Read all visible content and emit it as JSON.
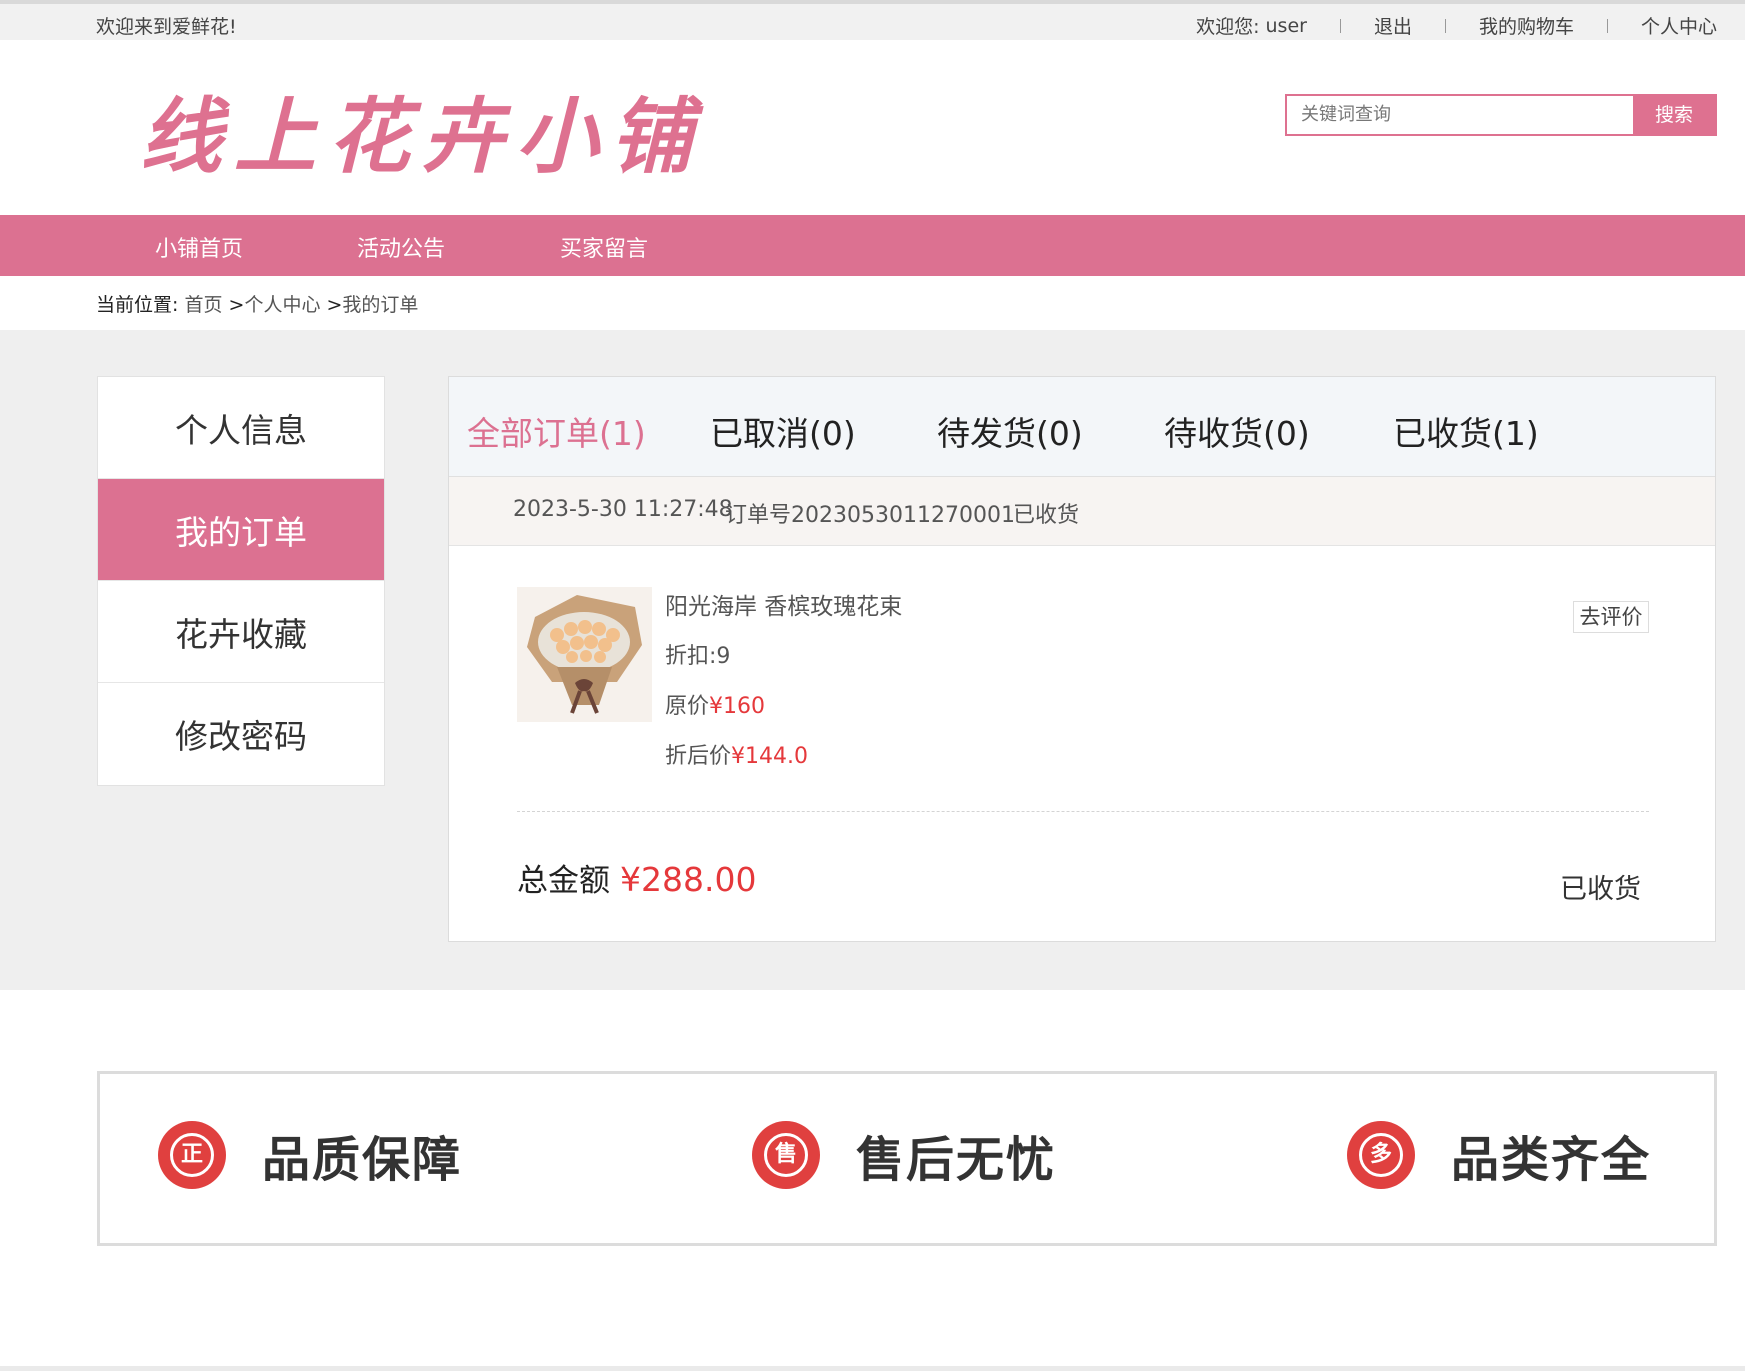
{
  "topbar": {
    "welcome": "欢迎来到爱鲜花!",
    "greeting": "欢迎您:",
    "username": "user",
    "logout": "退出",
    "cart": "我的购物车",
    "profile": "个人中心"
  },
  "header": {
    "logo_text": "线上花卉小铺",
    "search_placeholder": "关键词查询",
    "search_button": "搜索"
  },
  "nav": {
    "items": [
      "小铺首页",
      "活动公告",
      "买家留言"
    ]
  },
  "breadcrumb": {
    "label": "当前位置:",
    "home": "首页",
    "sep1": ">",
    "center": "个人中心",
    "sep2": ">",
    "current": "我的订单"
  },
  "sidebar": {
    "items": [
      "个人信息",
      "我的订单",
      "花卉收藏",
      "修改密码"
    ],
    "active": "我的订单"
  },
  "order_tabs": [
    {
      "label": "全部订单(1)"
    },
    {
      "label": "已取消(0)"
    },
    {
      "label": "待发货(0)"
    },
    {
      "label": "待收货(0)"
    },
    {
      "label": "已收货(1)"
    }
  ],
  "order": {
    "datetime": "2023-5-30 11:27:48",
    "order_no": "订单号2023053011270001",
    "status_head": "已收货",
    "product": {
      "name": "阳光海岸 香槟玫瑰花束",
      "discount_label": "折扣:",
      "discount": "9",
      "orig_label": "原价",
      "orig_price": "¥160",
      "final_label": "折后价",
      "final_price": "¥144.0"
    },
    "review_button": "去评价",
    "total_label": "总金额",
    "total_amount": "¥288.00",
    "status": "已收货"
  },
  "features": [
    {
      "icon": "正",
      "label": "品质保障"
    },
    {
      "icon": "售",
      "label": "售后无忧"
    },
    {
      "icon": "多",
      "label": "品类齐全"
    }
  ],
  "colors": {
    "brand_pink": "#dc7191",
    "price_red": "#e5383b",
    "badge_red": "#e0403f"
  }
}
